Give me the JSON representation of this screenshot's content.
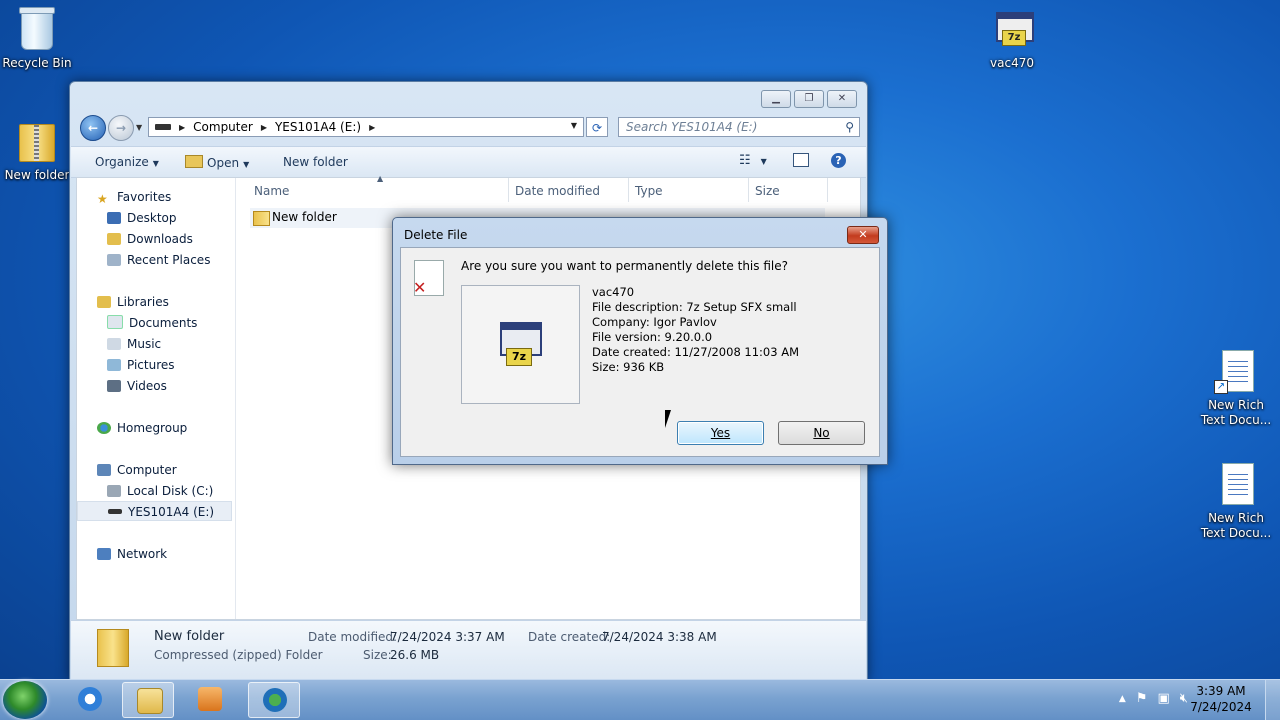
{
  "desktop": {
    "icons": [
      {
        "label": "Recycle Bin"
      },
      {
        "label": "New folder"
      },
      {
        "label": "vac470"
      },
      {
        "label": "New Rich\nText Docu..."
      },
      {
        "label": "New Rich\nText Docu..."
      }
    ]
  },
  "explorer": {
    "breadcrumb": [
      "Computer",
      "YES101A4 (E:)"
    ],
    "search_placeholder": "Search YES101A4 (E:)",
    "toolbar": {
      "organize": "Organize",
      "open": "Open",
      "new_folder": "New folder"
    },
    "nav": {
      "favorites": "Favorites",
      "desktop": "Desktop",
      "downloads": "Downloads",
      "recent": "Recent Places",
      "libraries": "Libraries",
      "documents": "Documents",
      "music": "Music",
      "pictures": "Pictures",
      "videos": "Videos",
      "homegroup": "Homegroup",
      "computer": "Computer",
      "local_disk": "Local Disk (C:)",
      "usb": "YES101A4 (E:)",
      "network": "Network"
    },
    "columns": {
      "name": "Name",
      "date": "Date modified",
      "type": "Type",
      "size": "Size"
    },
    "rows": [
      {
        "name": "New folder"
      }
    ],
    "details": {
      "name": "New folder",
      "type": "Compressed (zipped) Folder",
      "date_modified_label": "Date modified:",
      "date_modified": "7/24/2024 3:37 AM",
      "date_created_label": "Date created:",
      "date_created": "7/24/2024 3:38 AM",
      "size_label": "Size:",
      "size": "26.6 MB"
    }
  },
  "dialog": {
    "title": "Delete File",
    "question": "Are you sure you want to permanently delete this file?",
    "file_name": "vac470",
    "description": "File description: 7z Setup SFX small",
    "company": "Company: Igor Pavlov",
    "version": "File version: 9.20.0.0",
    "created": "Date created: 11/27/2008 11:03 AM",
    "size": "Size: 936 KB",
    "yes": "Yes",
    "no": "No"
  },
  "taskbar": {
    "time": "3:39 AM",
    "date": "7/24/2024"
  }
}
